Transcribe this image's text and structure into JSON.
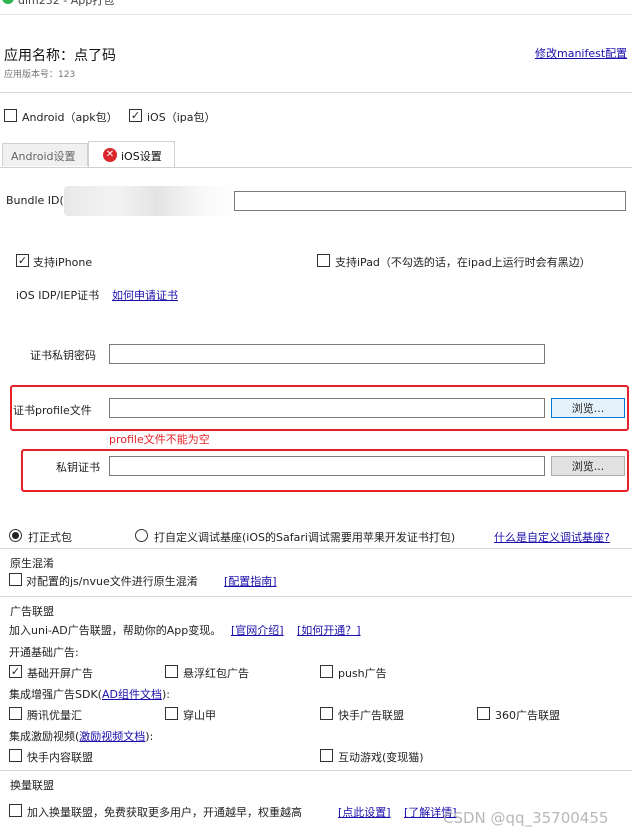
{
  "window": {
    "title": "dlm232 - App打包"
  },
  "app": {
    "name_label": "应用名称：点了码",
    "version_label": "应用版本号：123",
    "modify_link": "修改manifest配置"
  },
  "platforms": {
    "android_label": "Android（apk包）",
    "android_checked": false,
    "ios_label": "iOS（ipa包）",
    "ios_checked": true
  },
  "tabs": [
    {
      "label": "Android设置",
      "active": false
    },
    {
      "label": "iOS设置",
      "active": true
    }
  ],
  "ios": {
    "bundle_id_label": "Bundle ID(",
    "support_iphone_label": "支持iPhone",
    "support_ipad_label": "支持iPad（不勾选的话，在ipad上运行时会有黑边）",
    "cert_type_label": "iOS IDP/IEP证书",
    "cert_how_link": "如何申请证书",
    "cert_password_label": "证书私钥密码",
    "profile_label": "证书profile文件",
    "profile_browse": "浏览...",
    "profile_error": "profile文件不能为空",
    "private_key_label": "私钥证书",
    "private_key_browse": "浏览..."
  },
  "build_mode": {
    "release_label": "打正式包",
    "custom_label": "打自定义调试基座(iOS的Safari调试需要用苹果开发证书打包)",
    "custom_link": "什么是自定义调试基座?"
  },
  "native_obfuscation": {
    "title": "原生混淆",
    "checkbox_label": "对配置的js/nvue文件进行原生混淆",
    "guide_link": "[配置指南]"
  },
  "ad": {
    "title": "广告联盟",
    "desc": "加入uni-AD广告联盟，帮助你的App变现。",
    "intro_link": "[官网介绍]",
    "how_link": "[如何开通？]",
    "basic_title": "开通基础广告:",
    "basic_items": [
      {
        "label": "基础开屏广告",
        "checked": true
      },
      {
        "label": "悬浮红包广告",
        "checked": false
      },
      {
        "label": "push广告",
        "checked": false
      }
    ],
    "sdk_title_prefix": "集成增强广告SDK(",
    "sdk_doc_link": "AD组件文档",
    "sdk_title_suffix": "):",
    "sdk_items": [
      {
        "label": "腾讯优量汇"
      },
      {
        "label": "穿山甲"
      },
      {
        "label": "快手广告联盟"
      },
      {
        "label": "360广告联盟"
      }
    ],
    "video_title_prefix": "集成激励视频(",
    "video_doc_link": "激励视频文档",
    "video_title_suffix": "):",
    "video_items": [
      {
        "label": "快手内容联盟"
      },
      {
        "label": "互动游戏(变现猫)"
      }
    ]
  },
  "exchange": {
    "title": "换量联盟",
    "checkbox_label": "加入换量联盟，免费获取更多用户，开通越早，权重越高",
    "settings_link": "[点此设置]",
    "detail_link": "[了解详情]"
  },
  "watermark": "CSDN @qq_35700455",
  "colors": {
    "link": "#1a0dab",
    "error": "#e8202a",
    "highlight_box": "#e8202a",
    "error_icon": "#d9262c"
  }
}
